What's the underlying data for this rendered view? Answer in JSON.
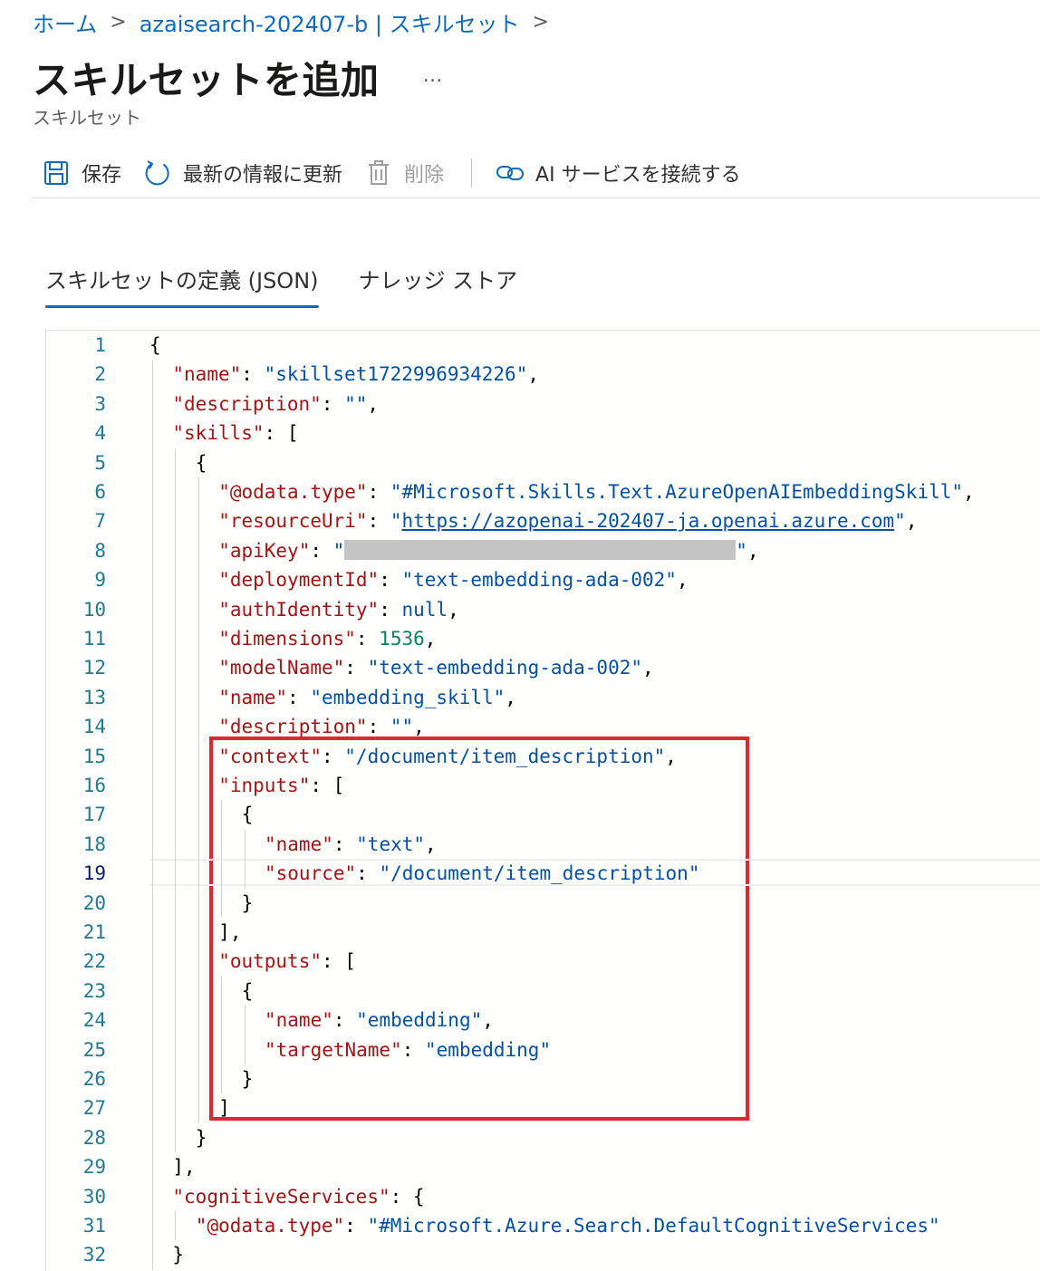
{
  "breadcrumb": {
    "home": "ホーム",
    "current": "azaisearch-202407-b | スキルセット",
    "separator": ">"
  },
  "header": {
    "title": "スキルセットを追加",
    "more": "…",
    "subtitle": "スキルセット"
  },
  "toolbar": {
    "save_label": "保存",
    "refresh_label": "最新の情報に更新",
    "delete_label": "削除",
    "connect_ai_label": "AI サービスを接続する"
  },
  "tabs": [
    {
      "label": "スキルセットの定義 (JSON)",
      "active": true
    },
    {
      "label": "ナレッジ ストア",
      "active": false
    }
  ],
  "editor": {
    "current_line": 19,
    "lines": [
      {
        "n": "1",
        "indent": 0,
        "tokens": [
          {
            "t": "p",
            "v": "{"
          }
        ]
      },
      {
        "n": "2",
        "indent": 1,
        "tokens": [
          {
            "t": "k",
            "v": "\"name\""
          },
          {
            "t": "p",
            "v": ": "
          },
          {
            "t": "s",
            "v": "\"skillset1722996934226\""
          },
          {
            "t": "p",
            "v": ","
          }
        ]
      },
      {
        "n": "3",
        "indent": 1,
        "tokens": [
          {
            "t": "k",
            "v": "\"description\""
          },
          {
            "t": "p",
            "v": ": "
          },
          {
            "t": "s",
            "v": "\"\""
          },
          {
            "t": "p",
            "v": ","
          }
        ]
      },
      {
        "n": "4",
        "indent": 1,
        "tokens": [
          {
            "t": "k",
            "v": "\"skills\""
          },
          {
            "t": "p",
            "v": ": ["
          }
        ]
      },
      {
        "n": "5",
        "indent": 2,
        "tokens": [
          {
            "t": "p",
            "v": "{"
          }
        ]
      },
      {
        "n": "6",
        "indent": 3,
        "tokens": [
          {
            "t": "k",
            "v": "\"@odata.type\""
          },
          {
            "t": "p",
            "v": ": "
          },
          {
            "t": "s",
            "v": "\"#Microsoft.Skills.Text.AzureOpenAIEmbeddingSkill\""
          },
          {
            "t": "p",
            "v": ","
          }
        ]
      },
      {
        "n": "7",
        "indent": 3,
        "tokens": [
          {
            "t": "k",
            "v": "\"resourceUri\""
          },
          {
            "t": "p",
            "v": ": "
          },
          {
            "t": "s",
            "v": "\""
          },
          {
            "t": "sl",
            "v": "https://azopenai-202407-ja.openai.azure.com"
          },
          {
            "t": "s",
            "v": "\""
          },
          {
            "t": "p",
            "v": ","
          }
        ]
      },
      {
        "n": "8",
        "indent": 3,
        "tokens": [
          {
            "t": "k",
            "v": "\"apiKey\""
          },
          {
            "t": "p",
            "v": ": "
          },
          {
            "t": "s",
            "v": "\""
          },
          {
            "t": "redacted",
            "v": ""
          },
          {
            "t": "s",
            "v": "\""
          },
          {
            "t": "p",
            "v": ","
          }
        ]
      },
      {
        "n": "9",
        "indent": 3,
        "tokens": [
          {
            "t": "k",
            "v": "\"deploymentId\""
          },
          {
            "t": "p",
            "v": ": "
          },
          {
            "t": "s",
            "v": "\"text-embedding-ada-002\""
          },
          {
            "t": "p",
            "v": ","
          }
        ]
      },
      {
        "n": "10",
        "indent": 3,
        "tokens": [
          {
            "t": "k",
            "v": "\"authIdentity\""
          },
          {
            "t": "p",
            "v": ": "
          },
          {
            "t": "s",
            "v": "null"
          },
          {
            "t": "p",
            "v": ","
          }
        ]
      },
      {
        "n": "11",
        "indent": 3,
        "tokens": [
          {
            "t": "k",
            "v": "\"dimensions\""
          },
          {
            "t": "p",
            "v": ": "
          },
          {
            "t": "n",
            "v": "1536"
          },
          {
            "t": "p",
            "v": ","
          }
        ]
      },
      {
        "n": "12",
        "indent": 3,
        "tokens": [
          {
            "t": "k",
            "v": "\"modelName\""
          },
          {
            "t": "p",
            "v": ": "
          },
          {
            "t": "s",
            "v": "\"text-embedding-ada-002\""
          },
          {
            "t": "p",
            "v": ","
          }
        ]
      },
      {
        "n": "13",
        "indent": 3,
        "tokens": [
          {
            "t": "k",
            "v": "\"name\""
          },
          {
            "t": "p",
            "v": ": "
          },
          {
            "t": "s",
            "v": "\"embedding_skill\""
          },
          {
            "t": "p",
            "v": ","
          }
        ]
      },
      {
        "n": "14",
        "indent": 3,
        "tokens": [
          {
            "t": "k",
            "v": "\"description\""
          },
          {
            "t": "p",
            "v": ": "
          },
          {
            "t": "s",
            "v": "\"\""
          },
          {
            "t": "p",
            "v": ","
          }
        ]
      },
      {
        "n": "15",
        "indent": 3,
        "tokens": [
          {
            "t": "k",
            "v": "\"context\""
          },
          {
            "t": "p",
            "v": ": "
          },
          {
            "t": "s",
            "v": "\"/document/item_description\""
          },
          {
            "t": "p",
            "v": ","
          }
        ]
      },
      {
        "n": "16",
        "indent": 3,
        "tokens": [
          {
            "t": "k",
            "v": "\"inputs\""
          },
          {
            "t": "p",
            "v": ": ["
          }
        ]
      },
      {
        "n": "17",
        "indent": 4,
        "tokens": [
          {
            "t": "p",
            "v": "{"
          }
        ]
      },
      {
        "n": "18",
        "indent": 5,
        "tokens": [
          {
            "t": "k",
            "v": "\"name\""
          },
          {
            "t": "p",
            "v": ": "
          },
          {
            "t": "s",
            "v": "\"text\""
          },
          {
            "t": "p",
            "v": ","
          }
        ]
      },
      {
        "n": "19",
        "indent": 5,
        "tokens": [
          {
            "t": "k",
            "v": "\"source\""
          },
          {
            "t": "p",
            "v": ": "
          },
          {
            "t": "s",
            "v": "\"/document/item_description\""
          }
        ]
      },
      {
        "n": "20",
        "indent": 4,
        "tokens": [
          {
            "t": "p",
            "v": "}"
          }
        ]
      },
      {
        "n": "21",
        "indent": 3,
        "tokens": [
          {
            "t": "p",
            "v": "],"
          }
        ]
      },
      {
        "n": "22",
        "indent": 3,
        "tokens": [
          {
            "t": "k",
            "v": "\"outputs\""
          },
          {
            "t": "p",
            "v": ": ["
          }
        ]
      },
      {
        "n": "23",
        "indent": 4,
        "tokens": [
          {
            "t": "p",
            "v": "{"
          }
        ]
      },
      {
        "n": "24",
        "indent": 5,
        "tokens": [
          {
            "t": "k",
            "v": "\"name\""
          },
          {
            "t": "p",
            "v": ": "
          },
          {
            "t": "s",
            "v": "\"embedding\""
          },
          {
            "t": "p",
            "v": ","
          }
        ]
      },
      {
        "n": "25",
        "indent": 5,
        "tokens": [
          {
            "t": "k",
            "v": "\"targetName\""
          },
          {
            "t": "p",
            "v": ": "
          },
          {
            "t": "s",
            "v": "\"embedding\""
          }
        ]
      },
      {
        "n": "26",
        "indent": 4,
        "tokens": [
          {
            "t": "p",
            "v": "}"
          }
        ]
      },
      {
        "n": "27",
        "indent": 3,
        "tokens": [
          {
            "t": "p",
            "v": "]"
          }
        ]
      },
      {
        "n": "28",
        "indent": 2,
        "tokens": [
          {
            "t": "p",
            "v": "}"
          }
        ]
      },
      {
        "n": "29",
        "indent": 1,
        "tokens": [
          {
            "t": "p",
            "v": "],"
          }
        ]
      },
      {
        "n": "30",
        "indent": 1,
        "tokens": [
          {
            "t": "k",
            "v": "\"cognitiveServices\""
          },
          {
            "t": "p",
            "v": ": {"
          }
        ]
      },
      {
        "n": "31",
        "indent": 2,
        "tokens": [
          {
            "t": "k",
            "v": "\"@odata.type\""
          },
          {
            "t": "p",
            "v": ": "
          },
          {
            "t": "s",
            "v": "\"#Microsoft.Azure.Search.DefaultCognitiveServices\""
          }
        ]
      },
      {
        "n": "32",
        "indent": 1,
        "tokens": [
          {
            "t": "p",
            "v": "}"
          }
        ]
      }
    ]
  },
  "colors": {
    "accent": "#0f6cbd",
    "json_key": "#a31515",
    "json_string": "#0451a5",
    "json_number": "#098658",
    "line_number": "#237893",
    "highlight_box": "#e0262f"
  },
  "icons": {
    "save": "save-icon",
    "refresh": "refresh-icon",
    "delete": "trash-icon",
    "connect": "link-icon"
  }
}
